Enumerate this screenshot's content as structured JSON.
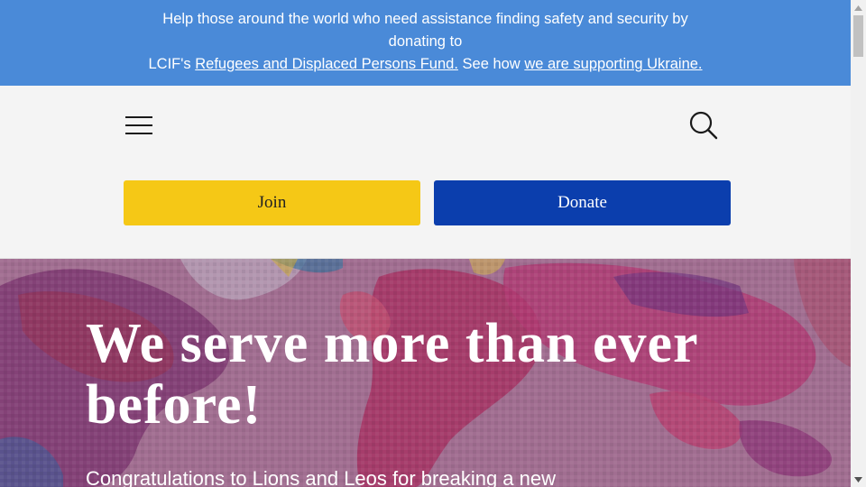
{
  "banner": {
    "line1": "Help those around the world who need assistance finding safety and security by donating to",
    "prefix": "LCIF's",
    "fund_link": "Refugees and Displaced Persons Fund.",
    "middle": "See how",
    "ukraine_link": "we are supporting Ukraine.",
    "color": "#4a8ad8"
  },
  "header": {
    "menu_icon": "hamburger-menu-icon",
    "search_icon": "search-icon",
    "join_label": "Join",
    "donate_label": "Donate",
    "join_color": "#f5c816",
    "donate_color": "#0b3ead"
  },
  "hero": {
    "title": "We serve more than ever before!",
    "subtitle": "Congratulations to Lions and Leos for breaking a new"
  }
}
